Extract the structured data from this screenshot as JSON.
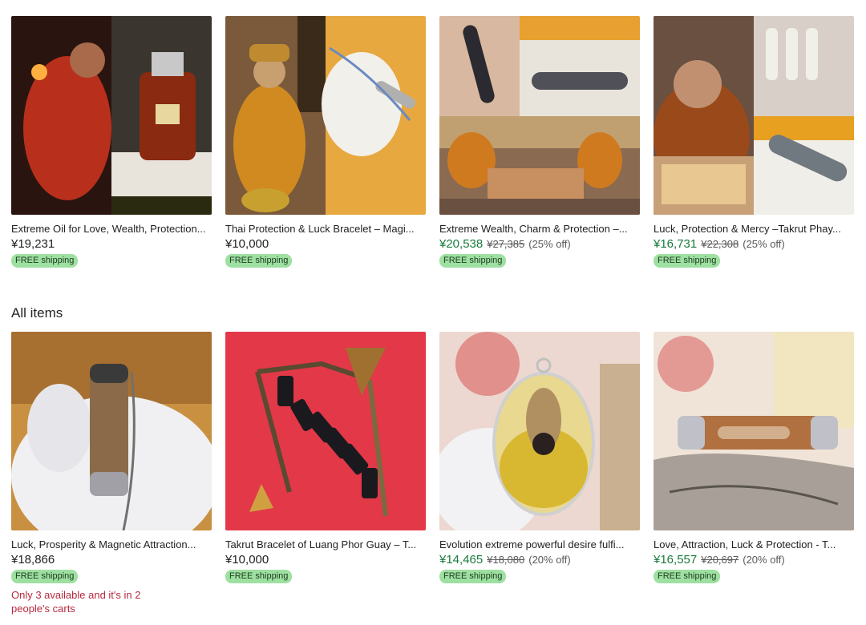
{
  "section_heading": "All items",
  "featured": [
    {
      "title": "Extreme Oil for Love, Wealth, Protection...",
      "price": "¥19,231",
      "original_price": "",
      "discount": "",
      "on_sale": false,
      "shipping": "FREE shipping"
    },
    {
      "title": "Thai Protection & Luck Bracelet – Magi...",
      "price": "¥10,000",
      "original_price": "",
      "discount": "",
      "on_sale": false,
      "shipping": "FREE shipping"
    },
    {
      "title": "Extreme Wealth, Charm & Protection –...",
      "price": "¥20,538",
      "original_price": "¥27,385",
      "discount": "(25% off)",
      "on_sale": true,
      "shipping": "FREE shipping"
    },
    {
      "title": "Luck, Protection & Mercy –Takrut Phay...",
      "price": "¥16,731",
      "original_price": "¥22,308",
      "discount": "(25% off)",
      "on_sale": true,
      "shipping": "FREE shipping"
    }
  ],
  "items": [
    {
      "title": "Luck, Prosperity & Magnetic Attraction...",
      "price": "¥18,866",
      "original_price": "",
      "discount": "",
      "on_sale": false,
      "shipping": "FREE shipping",
      "stock_note": "Only 3 available and it's in 2 people's carts"
    },
    {
      "title": "Takrut Bracelet of Luang Phor Guay – T...",
      "price": "¥10,000",
      "original_price": "",
      "discount": "",
      "on_sale": false,
      "shipping": "FREE shipping",
      "stock_note": ""
    },
    {
      "title": "Evolution extreme powerful desire fulfi...",
      "price": "¥14,465",
      "original_price": "¥18,080",
      "discount": "(20% off)",
      "on_sale": true,
      "shipping": "FREE shipping",
      "stock_note": ""
    },
    {
      "title": "Love, Attraction, Luck & Protection - T...",
      "price": "¥16,557",
      "original_price": "¥20,697",
      "discount": "(20% off)",
      "on_sale": true,
      "shipping": "FREE shipping",
      "stock_note": ""
    }
  ]
}
